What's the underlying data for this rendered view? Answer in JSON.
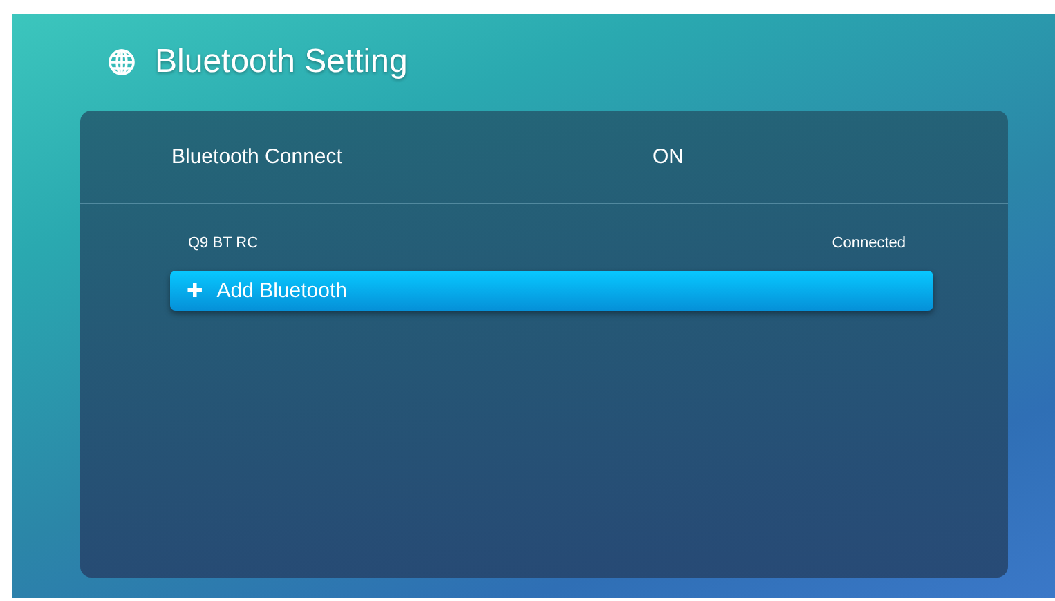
{
  "header": {
    "title": "Bluetooth Setting"
  },
  "connect": {
    "label": "Bluetooth Connect",
    "value": "ON"
  },
  "items": [
    {
      "kind": "device",
      "name": "Q9 BT RC",
      "status": "Connected",
      "selected": false
    },
    {
      "kind": "action",
      "icon": "✚",
      "label": "Add Bluetooth",
      "selected": true
    }
  ]
}
